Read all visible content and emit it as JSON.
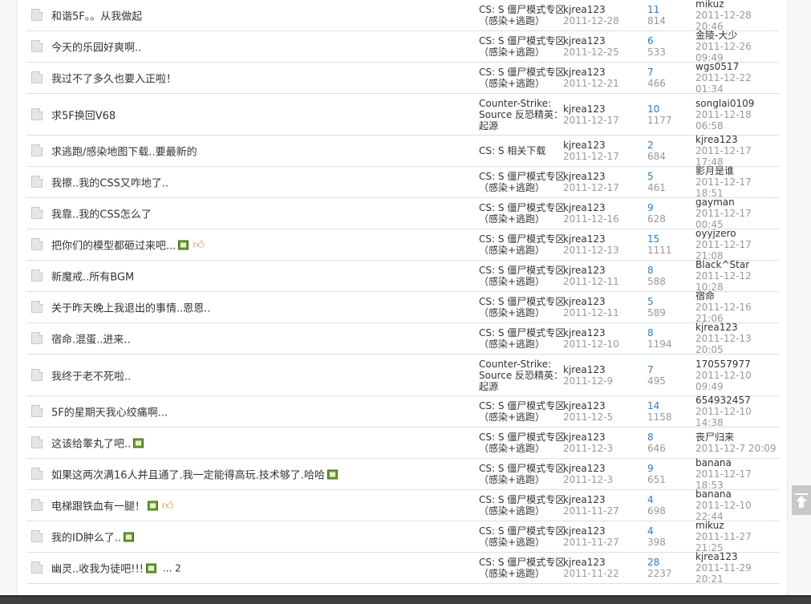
{
  "threads": [
    {
      "title": "和谐5F。。从我做起",
      "forum": "CS: S 僵尸模式专区（感染+逃跑）",
      "author": "kjrea123",
      "date": "2011-12-28",
      "replies": "11",
      "views": "814",
      "last_user": "mikuz",
      "last_time": "2011-12-28 20:46",
      "img": false,
      "thumb": false,
      "pages": ""
    },
    {
      "title": "今天的乐园好爽啊..",
      "forum": "CS: S 僵尸模式专区（感染+逃跑）",
      "author": "kjrea123",
      "date": "2011-12-25",
      "replies": "6",
      "views": "533",
      "last_user": "金陵-大少",
      "last_time": "2011-12-26 09:49",
      "img": false,
      "thumb": false,
      "pages": ""
    },
    {
      "title": "我过不了多久也要入正啦！",
      "forum": "CS: S 僵尸模式专区（感染+逃跑）",
      "author": "kjrea123",
      "date": "2011-12-21",
      "replies": "7",
      "views": "466",
      "last_user": "wgs0517",
      "last_time": "2011-12-22 01:34",
      "img": false,
      "thumb": false,
      "pages": ""
    },
    {
      "title": "求5F换回V68",
      "forum": "Counter-Strike: Source 反恐精英：起源",
      "author": "kjrea123",
      "date": "2011-12-17",
      "replies": "10",
      "views": "1177",
      "last_user": "songlai0109",
      "last_time": "2011-12-18 06:58",
      "img": false,
      "thumb": false,
      "pages": "",
      "tall": true
    },
    {
      "title": "求逃跑/感染地图下载..要最新的",
      "forum": "CS: S 相关下载",
      "author": "kjrea123",
      "date": "2011-12-17",
      "replies": "2",
      "views": "684",
      "last_user": "kjrea123",
      "last_time": "2011-12-17 17:48",
      "img": false,
      "thumb": false,
      "pages": ""
    },
    {
      "title": "我擦..我的CSS又咋地了..",
      "forum": "CS: S 僵尸模式专区（感染+逃跑）",
      "author": "kjrea123",
      "date": "2011-12-17",
      "replies": "5",
      "views": "461",
      "last_user": "影月是谁",
      "last_time": "2011-12-17 18:51",
      "img": false,
      "thumb": false,
      "pages": ""
    },
    {
      "title": "我靠..我的CSS怎么了",
      "forum": "CS: S 僵尸模式专区（感染+逃跑）",
      "author": "kjrea123",
      "date": "2011-12-16",
      "replies": "9",
      "views": "628",
      "last_user": "gayman",
      "last_time": "2011-12-17 00:45",
      "img": false,
      "thumb": false,
      "pages": ""
    },
    {
      "title": "把你们的模型都砸过来吧...",
      "forum": "CS: S 僵尸模式专区（感染+逃跑）",
      "author": "kjrea123",
      "date": "2011-12-13",
      "replies": "15",
      "views": "1111",
      "last_user": "oyyjzero",
      "last_time": "2011-12-17 21:08",
      "img": true,
      "thumb": true,
      "pages": ""
    },
    {
      "title": "新魔戒..所有BGM",
      "forum": "CS: S 僵尸模式专区（感染+逃跑）",
      "author": "kjrea123",
      "date": "2011-12-11",
      "replies": "8",
      "views": "588",
      "last_user": "Black^Star",
      "last_time": "2011-12-12 10:28",
      "img": false,
      "thumb": false,
      "pages": ""
    },
    {
      "title": "关于昨天晚上我退出的事情..恩恩..",
      "forum": "CS: S 僵尸模式专区（感染+逃跑）",
      "author": "kjrea123",
      "date": "2011-12-11",
      "replies": "5",
      "views": "589",
      "last_user": "宿命",
      "last_time": "2011-12-16 21:06",
      "img": false,
      "thumb": false,
      "pages": ""
    },
    {
      "title": "宿命.混蛋..进来..",
      "forum": "CS: S 僵尸模式专区（感染+逃跑）",
      "author": "kjrea123",
      "date": "2011-12-10",
      "replies": "8",
      "views": "1194",
      "last_user": "kjrea123",
      "last_time": "2011-12-13 20:05",
      "img": false,
      "thumb": false,
      "pages": ""
    },
    {
      "title": "我终于老不死啦..",
      "forum": "Counter-Strike: Source 反恐精英：起源",
      "author": "kjrea123",
      "date": "2011-12-9",
      "replies": "7",
      "views": "495",
      "last_user": "170557977",
      "last_time": "2011-12-10 09:49",
      "img": false,
      "thumb": false,
      "pages": "",
      "tall": true
    },
    {
      "title": "5F的星期天我心绞痛啊...",
      "forum": "CS: S 僵尸模式专区（感染+逃跑）",
      "author": "kjrea123",
      "date": "2011-12-5",
      "replies": "14",
      "views": "1158",
      "last_user": "654932457",
      "last_time": "2011-12-10 14:38",
      "img": false,
      "thumb": false,
      "pages": ""
    },
    {
      "title": "这该给睾丸了吧..",
      "forum": "CS: S 僵尸模式专区（感染+逃跑）",
      "author": "kjrea123",
      "date": "2011-12-3",
      "replies": "8",
      "views": "646",
      "last_user": "丧尸归来",
      "last_time": "2011-12-7 20:09",
      "img": true,
      "thumb": false,
      "pages": ""
    },
    {
      "title": "如果这两次满16人并且通了.我一定能得高玩.技术够了.哈哈",
      "forum": "CS: S 僵尸模式专区（感染+逃跑）",
      "author": "kjrea123",
      "date": "2011-12-3",
      "replies": "9",
      "views": "651",
      "last_user": "banana",
      "last_time": "2011-12-17 18:53",
      "img": true,
      "thumb": false,
      "pages": ""
    },
    {
      "title": "电梯跟铁血有一腿！",
      "forum": "CS: S 僵尸模式专区（感染+逃跑）",
      "author": "kjrea123",
      "date": "2011-11-27",
      "replies": "4",
      "views": "698",
      "last_user": "banana",
      "last_time": "2011-12-10 22:44",
      "img": true,
      "thumb": true,
      "pages": ""
    },
    {
      "title": "我的ID肿么了..",
      "forum": "CS: S 僵尸模式专区（感染+逃跑）",
      "author": "kjrea123",
      "date": "2011-11-27",
      "replies": "4",
      "views": "398",
      "last_user": "mikuz",
      "last_time": "2011-11-27 21:25",
      "img": true,
      "thumb": false,
      "pages": ""
    },
    {
      "title": "幽灵..收我为徒吧!!!",
      "forum": "CS: S 僵尸模式专区（感染+逃跑）",
      "author": "kjrea123",
      "date": "2011-11-22",
      "replies": "28",
      "views": "2237",
      "last_user": "kjrea123",
      "last_time": "2011-11-29 20:21",
      "img": true,
      "thumb": false,
      "pages": "... 2"
    }
  ],
  "icons": {
    "thread": "document-icon",
    "attachment": "image-attachment-icon",
    "rating": "thumbs-up-icon",
    "back_to_top": "arrow-up-icon"
  },
  "colors": {
    "reply_count": "#2b7acb",
    "muted": "#999999",
    "row_border": "#d4e2e8",
    "text": "#333333"
  }
}
